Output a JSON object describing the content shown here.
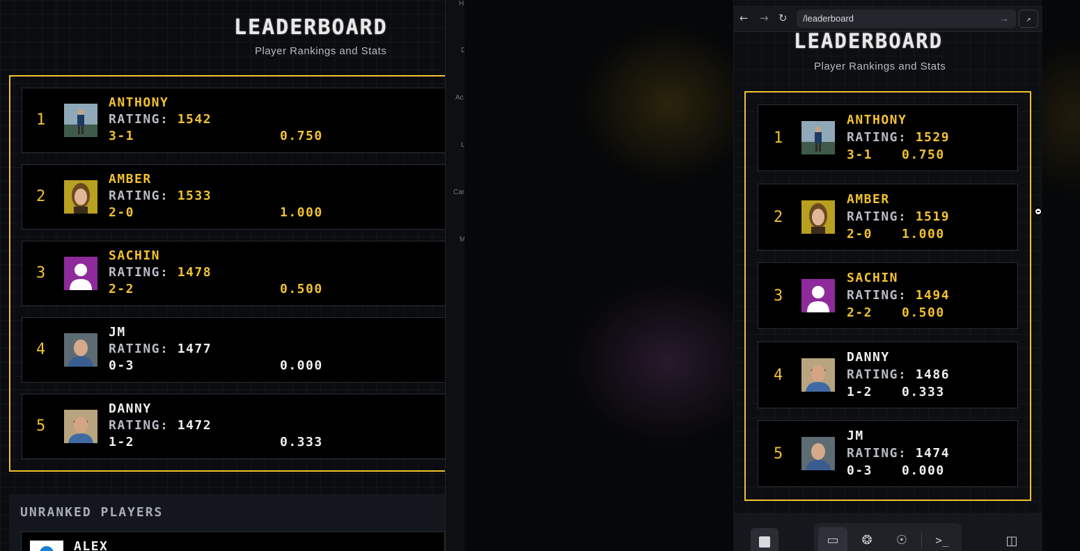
{
  "left": {
    "title": "LEADERBOARD",
    "subtitle": "Player Rankings and Stats",
    "rating_label": "RATING:",
    "players": [
      {
        "rank": "1",
        "name": "ANTHONY",
        "rating": "1542",
        "record": "3-1",
        "pct": "0.750",
        "avatar": "photo-hiker",
        "tone": "gold"
      },
      {
        "rank": "2",
        "name": "AMBER",
        "rating": "1533",
        "record": "2-0",
        "pct": "1.000",
        "avatar": "photo-woman",
        "tone": "gold"
      },
      {
        "rank": "3",
        "name": "SACHIN",
        "rating": "1478",
        "record": "2-2",
        "pct": "0.500",
        "avatar": "default-avatar",
        "tone": "gold"
      },
      {
        "rank": "4",
        "name": "JM",
        "rating": "1477",
        "record": "0-3",
        "pct": "0.000",
        "avatar": "photo-man-bald",
        "tone": "white"
      },
      {
        "rank": "5",
        "name": "DANNY",
        "rating": "1472",
        "record": "1-2",
        "pct": "0.333",
        "avatar": "photo-man-smiling",
        "tone": "white"
      }
    ],
    "unranked": {
      "title": "UNRANKED PLAYERS",
      "first_player": "ALEX"
    }
  },
  "divider_labels": [
    "H",
    "D",
    "Ac",
    "L",
    "Car",
    "M"
  ],
  "browser": {
    "url": "/leaderboard",
    "title": "LEADERBOARD",
    "subtitle": "Player Rankings and Stats",
    "rating_label": "RATING:",
    "players": [
      {
        "rank": "1",
        "name": "ANTHONY",
        "rating": "1529",
        "record": "3-1",
        "pct": "0.750",
        "avatar": "photo-hiker",
        "tone": "gold"
      },
      {
        "rank": "2",
        "name": "AMBER",
        "rating": "1519",
        "record": "2-0",
        "pct": "1.000",
        "avatar": "photo-woman",
        "tone": "gold"
      },
      {
        "rank": "3",
        "name": "SACHIN",
        "rating": "1494",
        "record": "2-2",
        "pct": "0.500",
        "avatar": "default-avatar",
        "tone": "gold"
      },
      {
        "rank": "4",
        "name": "DANNY",
        "rating": "1486",
        "record": "1-2",
        "pct": "0.333",
        "avatar": "photo-man-smiling",
        "tone": "white"
      },
      {
        "rank": "5",
        "name": "JM",
        "rating": "1474",
        "record": "0-3",
        "pct": "0.000",
        "avatar": "photo-man-bald",
        "tone": "white"
      }
    ],
    "toolbar_icons": [
      "stop-icon",
      "desktop-icon",
      "grid-icon",
      "tree-icon",
      "terminal-icon",
      "panel-toggle-icon"
    ]
  },
  "colors": {
    "accent": "#f2c230",
    "card_bg": "#000000",
    "text_light": "#f1f1f1",
    "label_grey": "#b9bcc4"
  }
}
